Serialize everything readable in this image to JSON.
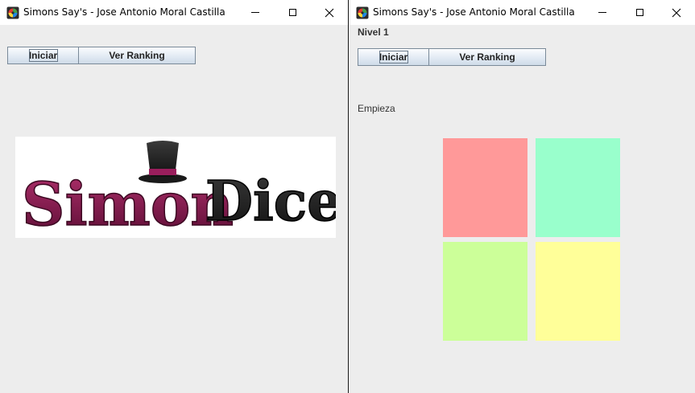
{
  "left_window": {
    "title": "Simons Say's - Jose Antonio Moral Castilla",
    "buttons": {
      "start_label": "Iniciar",
      "ranking_label": "Ver Ranking"
    },
    "logo": {
      "part1": "Simon",
      "part2": "Dice"
    }
  },
  "right_window": {
    "title": "Simons Say's - Jose Antonio Moral Castilla",
    "level": "Nivel 1",
    "buttons": {
      "start_label": "Iniciar",
      "ranking_label": "Ver Ranking"
    },
    "status": "Empieza",
    "tiles": [
      {
        "name": "red",
        "color": "#ff9999"
      },
      {
        "name": "green",
        "color": "#99ffcc"
      },
      {
        "name": "lime",
        "color": "#ccff99"
      },
      {
        "name": "yellow",
        "color": "#ffff99"
      }
    ]
  },
  "colors": {
    "window_bg": "#ededed",
    "logo_magenta": "#8b1a55",
    "logo_black": "#1f1f1f"
  },
  "icons": {
    "app": "app-icon",
    "minimize": "minimize-icon",
    "maximize": "maximize-icon",
    "close": "close-icon"
  }
}
